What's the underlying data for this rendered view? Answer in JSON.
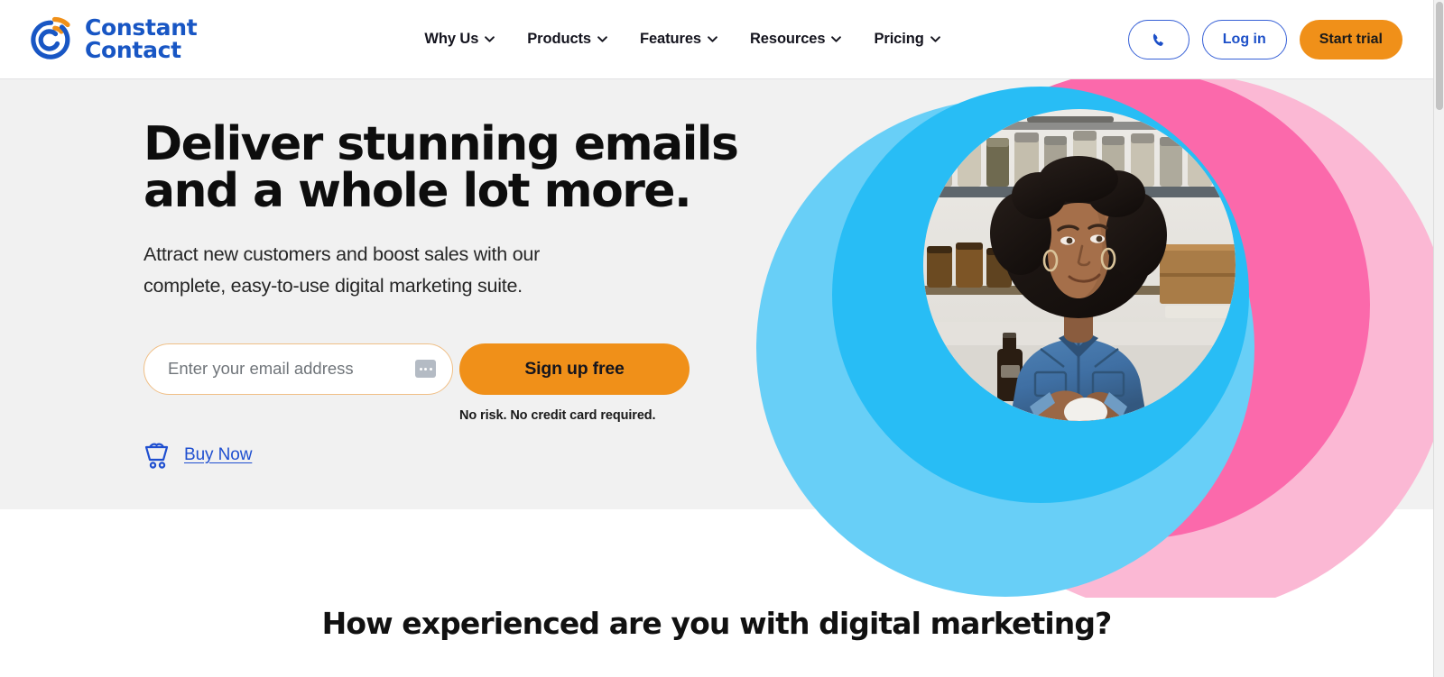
{
  "brand": {
    "name_line1": "Constant",
    "name_line2": "Contact",
    "logo_icon": "constant-contact-swirl-logo",
    "blue": "#1856c4",
    "orange": "#f09019",
    "link_blue": "#1f4fd0"
  },
  "header": {
    "nav": [
      {
        "label": "Why Us",
        "icon": "chevron-down-icon"
      },
      {
        "label": "Products",
        "icon": "chevron-down-icon"
      },
      {
        "label": "Features",
        "icon": "chevron-down-icon"
      },
      {
        "label": "Resources",
        "icon": "chevron-down-icon"
      },
      {
        "label": "Pricing",
        "icon": "chevron-down-icon"
      }
    ],
    "phone_icon": "phone-icon",
    "login_label": "Log in",
    "trial_label": "Start trial"
  },
  "hero": {
    "title": "Deliver stunning emails\nand a whole lot more.",
    "subtitle": "Attract new customers and boost sales with our\ncomplete, easy-to-use digital marketing suite.",
    "email_placeholder": "Enter your email address",
    "email_value": "",
    "autofill_icon": "autofill-ellipsis-icon",
    "signup_label": "Sign up free",
    "disclaimer": "No risk. No credit card required.",
    "buy_now_label": "Buy Now",
    "cart_icon": "shopping-cart-icon",
    "art": {
      "description": "Overlapping pink and blue circles framing a circular photo of a smiling woman with curly hair in a denim shirt holding a mug in a shop",
      "pink_pale": "#fbb8d4",
      "pink": "#fb69ab",
      "blue_light": "#68cff7",
      "blue": "#28bdf5"
    },
    "background": "#f1f1f1"
  },
  "section2": {
    "heading": "How experienced are you with digital marketing?"
  }
}
